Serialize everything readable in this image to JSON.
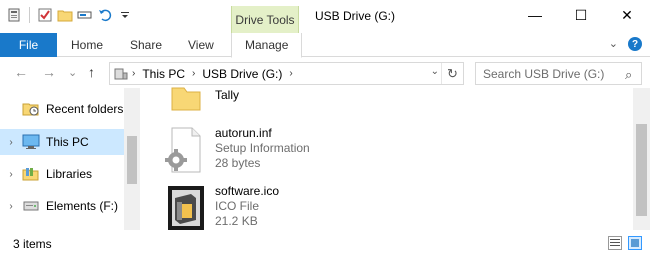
{
  "quick_access": {
    "icons": [
      "properties-icon",
      "checkmark-icon",
      "new-folder-icon",
      "rename-icon",
      "undo-icon",
      "customize-dropdown-icon"
    ]
  },
  "context_tab_group": "Drive Tools",
  "window_title": "USB Drive (G:)",
  "window_controls": {
    "minimize": "—",
    "maximize": "☐",
    "close": "✕"
  },
  "ribbon": {
    "tabs": [
      {
        "label": "File"
      },
      {
        "label": "Home"
      },
      {
        "label": "Share"
      },
      {
        "label": "View"
      },
      {
        "label": "Manage"
      }
    ],
    "expand_glyph": "⌄",
    "help_glyph": "?"
  },
  "nav_buttons": {
    "back": "←",
    "forward": "→",
    "recent": "⌄",
    "up": "↑"
  },
  "address": {
    "crumbs": [
      "This PC",
      "USB Drive (G:)"
    ],
    "separator": "›",
    "dropdown": "⌄",
    "refresh": "↻"
  },
  "search": {
    "placeholder": "Search USB Drive (G:)",
    "icon": "⌕"
  },
  "nav_pane": {
    "items": [
      {
        "label": "Recent folders",
        "expand": "",
        "icon": "recent-folders-icon"
      },
      {
        "label": "This PC",
        "expand": "›",
        "icon": "computer-icon",
        "selected": true
      },
      {
        "label": "Libraries",
        "expand": "›",
        "icon": "libraries-icon"
      },
      {
        "label": "Elements (F:)",
        "expand": "›",
        "icon": "drive-icon"
      }
    ]
  },
  "files": [
    {
      "name": "Tally",
      "type": "",
      "size": "",
      "icon": "folder-icon"
    },
    {
      "name": "autorun.inf",
      "type": "Setup Information",
      "size": "28 bytes",
      "icon": "setup-file-icon"
    },
    {
      "name": "software.ico",
      "type": "ICO File",
      "size": "21.2 KB",
      "icon": "ico-file-icon"
    }
  ],
  "status": {
    "item_count": "3 items"
  },
  "colors": {
    "accent": "#1979ca",
    "selection": "#cce8ff",
    "context_tab": "#e4f0c8"
  }
}
